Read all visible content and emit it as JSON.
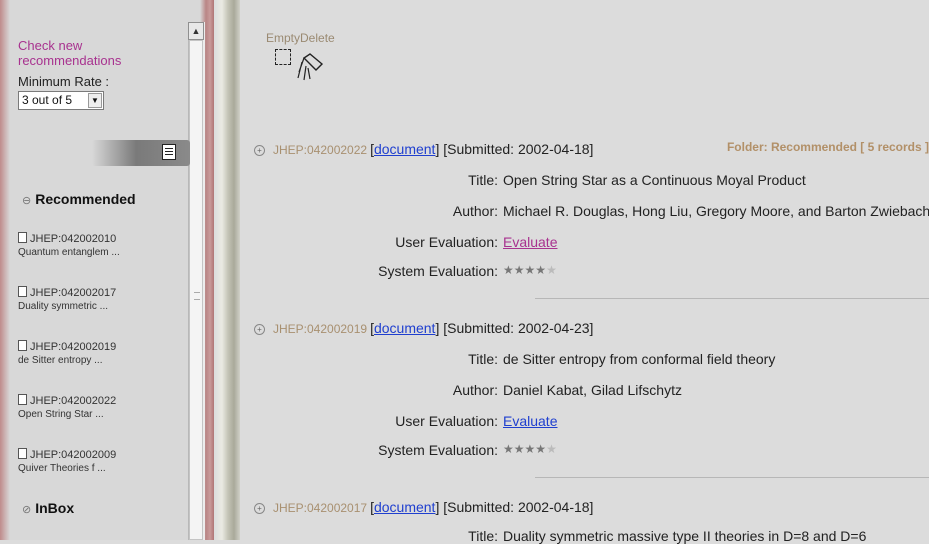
{
  "sidebar": {
    "check_new": "Check new recommendations",
    "minimum_rate_label": "Minimum Rate :",
    "rate_select": "3 out of 5",
    "recommended_title": "Recommended",
    "items": [
      {
        "id": "JHEP:042002010",
        "desc": "Quantum entanglem ..."
      },
      {
        "id": "JHEP:042002017",
        "desc": "Duality symmetric ..."
      },
      {
        "id": "JHEP:042002019",
        "desc": "de Sitter entropy ..."
      },
      {
        "id": "JHEP:042002022",
        "desc": "Open String Star ..."
      },
      {
        "id": "JHEP:042002009",
        "desc": "Quiver Theories f ..."
      }
    ],
    "inbox_title": "InBox"
  },
  "toolbar": {
    "label": "EmptyDelete"
  },
  "folder_info": "Folder: Recommended [ 5 records ]",
  "labels": {
    "title": "Title:",
    "author": "Author:",
    "user_eval": "User Evaluation:",
    "system_eval": "System Evaluation:"
  },
  "records": [
    {
      "id": "JHEP:042002022",
      "doc_link": "document",
      "submitted": "[Submitted: 2002-04-18]",
      "title": "Open String Star as a Continuous Moyal Product",
      "author": "Michael R. Douglas, Hong Liu, Gregory Moore, and Barton Zwiebach",
      "evaluate": "Evaluate",
      "rating": 4
    },
    {
      "id": "JHEP:042002019",
      "doc_link": "document",
      "submitted": "[Submitted: 2002-04-23]",
      "title": "de Sitter entropy from conformal field theory",
      "author": "Daniel Kabat, Gilad Lifschytz",
      "evaluate": "Evaluate",
      "rating": 4
    },
    {
      "id": "JHEP:042002017",
      "doc_link": "document",
      "submitted": "[Submitted: 2002-04-18]",
      "title": "Duality symmetric massive type II theories in D=8 and D=6"
    }
  ]
}
